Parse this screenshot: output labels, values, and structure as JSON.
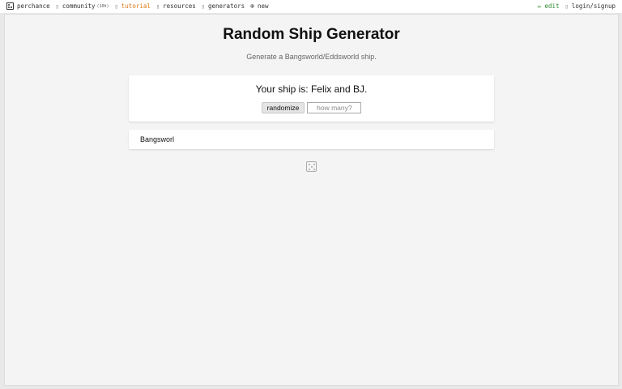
{
  "nav": {
    "home": {
      "label": "perchance",
      "icon": "dice-icon"
    },
    "community": {
      "label": "community",
      "badge": "(10h)",
      "icon": "chat-icon"
    },
    "tutorial": {
      "label": "tutorial",
      "icon": "book-icon"
    },
    "resources": {
      "label": "resources",
      "icon": "folder-icon"
    },
    "generators": {
      "label": "generators",
      "icon": "list-icon"
    },
    "new": {
      "label": "new",
      "icon": "plus-circle-icon"
    },
    "edit": {
      "label": "edit",
      "icon": "pencil-icon"
    },
    "login": {
      "label": "login/signup",
      "icon": "user-icon"
    }
  },
  "page": {
    "title": "Random Ship Generator",
    "subtitle": "Generate a Bangsworld/Eddsworld ship."
  },
  "result": {
    "text": "Your ship is: Felix and BJ."
  },
  "controls": {
    "randomize_label": "randomize",
    "count_placeholder": "how many?"
  },
  "text_card": {
    "text": "Bangsworl"
  },
  "colors": {
    "tutorial": "#d97a1a",
    "edit": "#2f8a2f",
    "page_bg": "#f4f4f4"
  }
}
